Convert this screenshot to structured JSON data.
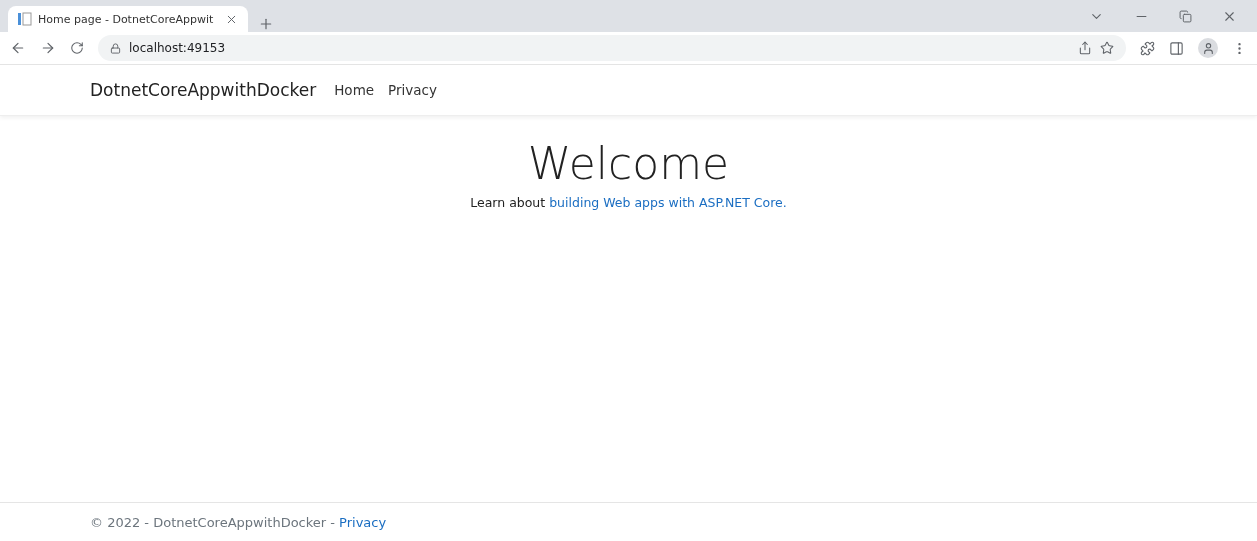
{
  "browser": {
    "tab": {
      "title": "Home page - DotnetCoreAppwit",
      "selected": true
    },
    "address": "localhost:49153"
  },
  "navbar": {
    "brand": "DotnetCoreAppwithDocker",
    "links": [
      {
        "label": "Home"
      },
      {
        "label": "Privacy"
      }
    ]
  },
  "main": {
    "heading": "Welcome",
    "lead": {
      "text": "Learn about ",
      "link": "building Web apps with ASP.NET Core."
    }
  },
  "footer": {
    "text": "© 2022 - DotnetCoreAppwithDocker - ",
    "link": "Privacy"
  }
}
